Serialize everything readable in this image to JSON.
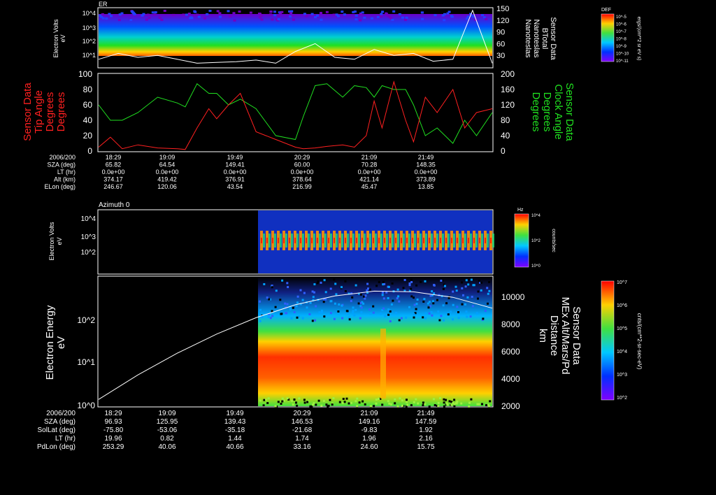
{
  "chart_data": [
    {
      "type": "heatmap",
      "panel": "er-spectrogram",
      "title": "ER",
      "ylabel": "Electron Volts",
      "yunit": "eV",
      "yticks": [
        "10^4",
        "10^3",
        "10^2",
        "10^1"
      ],
      "ylabel_right": [
        "Sensor Data",
        "BTotal",
        "Nanoteslas",
        "Nanoteslas"
      ],
      "yticks_right": [
        150,
        120,
        90,
        60,
        30
      ],
      "ylim_right": [
        0,
        150
      ],
      "colorbar": {
        "title": "DEF",
        "label": "ergs/(cm**2 sr eV s)",
        "ticks": [
          "10^-5",
          "10^-6",
          "10^-7",
          "10^-8",
          "10^-9",
          "10^-10",
          "10^-11"
        ]
      },
      "series": [
        {
          "name": "BTotal",
          "x": [
            0,
            0.05,
            0.1,
            0.15,
            0.2,
            0.25,
            0.3,
            0.35,
            0.4,
            0.45,
            0.5,
            0.55,
            0.6,
            0.65,
            0.7,
            0.75,
            0.8,
            0.85,
            0.9,
            0.95,
            1.0
          ],
          "values": [
            20,
            35,
            25,
            30,
            20,
            10,
            12,
            14,
            18,
            10,
            40,
            60,
            25,
            20,
            45,
            30,
            35,
            15,
            20,
            145,
            10
          ]
        }
      ]
    },
    {
      "type": "line",
      "panel": "mag-angles",
      "ylabel_left": [
        "Sensor Data",
        "Tip Angle",
        "Degrees",
        "Degrees"
      ],
      "ylabel_right": [
        "Sensor Data",
        "Clock Angle",
        "Degrees",
        "Degrees"
      ],
      "ylim_left": [
        0,
        100
      ],
      "ylim_right": [
        0,
        200
      ],
      "yticks_left": [
        100,
        80,
        60,
        40,
        20,
        0
      ],
      "yticks_right": [
        200,
        160,
        120,
        80,
        40,
        0
      ],
      "series": [
        {
          "name": "Tip Angle",
          "color": "#ff2020",
          "x": [
            0,
            0.03,
            0.06,
            0.1,
            0.15,
            0.2,
            0.22,
            0.25,
            0.28,
            0.3,
            0.33,
            0.36,
            0.4,
            0.45,
            0.5,
            0.52,
            0.55,
            0.58,
            0.62,
            0.65,
            0.68,
            0.7,
            0.72,
            0.75,
            0.78,
            0.8,
            0.83,
            0.86,
            0.9,
            0.93,
            0.96,
            1.0
          ],
          "values": [
            5,
            18,
            3,
            8,
            4,
            3,
            2,
            30,
            55,
            42,
            60,
            75,
            25,
            15,
            5,
            3,
            4,
            6,
            8,
            5,
            20,
            65,
            30,
            90,
            40,
            12,
            70,
            50,
            80,
            30,
            50,
            55
          ]
        },
        {
          "name": "Clock Angle",
          "color": "#20e020",
          "x": [
            0,
            0.03,
            0.06,
            0.1,
            0.15,
            0.2,
            0.22,
            0.25,
            0.28,
            0.3,
            0.33,
            0.36,
            0.4,
            0.45,
            0.5,
            0.52,
            0.55,
            0.58,
            0.62,
            0.65,
            0.68,
            0.7,
            0.72,
            0.75,
            0.78,
            0.8,
            0.83,
            0.86,
            0.9,
            0.93,
            0.96,
            1.0
          ],
          "values": [
            120,
            80,
            80,
            100,
            140,
            125,
            115,
            175,
            150,
            150,
            120,
            135,
            110,
            40,
            30,
            90,
            170,
            175,
            140,
            170,
            165,
            140,
            170,
            160,
            160,
            120,
            40,
            60,
            20,
            80,
            40,
            100
          ]
        }
      ]
    },
    {
      "type": "heatmap",
      "panel": "azimuth-spectrogram",
      "title": "Azimuth 0",
      "ylabel": "Electron Volts",
      "yunit": "eV",
      "yticks": [
        "10^4",
        "10^3",
        "10^2"
      ],
      "colorbar": {
        "title": "Hz",
        "label": "counts/sec",
        "ticks": [
          "10^4",
          "10^2",
          "10^0"
        ]
      }
    },
    {
      "type": "heatmap",
      "panel": "electron-energy-spectrogram",
      "ylabel": "Electron Energy",
      "yunit": "eV",
      "yticks": [
        "10^2",
        "10^1",
        "10^0"
      ],
      "ylabel_right": [
        "Sensor Data",
        "MEx Alt/Mars/Pd",
        "Distance",
        "km"
      ],
      "yticks_right": [
        10000,
        8000,
        6000,
        4000,
        2000
      ],
      "ylim_right": [
        2000,
        11500
      ],
      "colorbar": {
        "label": "cnts/(cm**2-sr-sec-eV)",
        "ticks": [
          "10^7",
          "10^6",
          "10^5",
          "10^4",
          "10^3",
          "10^2"
        ]
      },
      "series": [
        {
          "name": "MEx Alt/Mars/Pd",
          "x": [
            0,
            0.1,
            0.2,
            0.3,
            0.4,
            0.5,
            0.6,
            0.7,
            0.8,
            0.9,
            1.0
          ],
          "values": [
            2500,
            4300,
            5900,
            7300,
            8500,
            9450,
            10100,
            10450,
            10400,
            10000,
            9200
          ]
        }
      ]
    }
  ],
  "ephem1": {
    "labels": [
      "2006/200",
      "SZA (deg)",
      "LT (hr)",
      "Alt (km)",
      "ELon (deg)"
    ],
    "columns": [
      [
        "18:29",
        "65.82",
        "0.0e+00",
        "374.17",
        "246.67"
      ],
      [
        "19:09",
        "64.54",
        "0.0e+00",
        "419.42",
        "120.06"
      ],
      [
        "19:49",
        "149.41",
        "0.0e+00",
        "376.91",
        "43.54"
      ],
      [
        "20:29",
        "60.00",
        "0.0e+00",
        "378.64",
        "216.99"
      ],
      [
        "21:09",
        "70.28",
        "0.0e+00",
        "421.14",
        "45.47"
      ],
      [
        "21:49",
        "148.35",
        "0.0e+00",
        "373.89",
        "13.85"
      ]
    ]
  },
  "ephem2": {
    "labels": [
      "2006/200",
      "SZA (deg)",
      "SolLat (deg)",
      "LT (hr)",
      "PdLon (deg)"
    ],
    "columns": [
      [
        "18:29",
        "96.93",
        "-75.80",
        "19.96",
        "253.29"
      ],
      [
        "19:09",
        "125.95",
        "-53.06",
        "0.82",
        "40.06"
      ],
      [
        "19:49",
        "139.43",
        "-35.18",
        "1.44",
        "40.66"
      ],
      [
        "20:29",
        "146.53",
        "-21.68",
        "1.74",
        "33.16"
      ],
      [
        "21:09",
        "149.16",
        "-9.83",
        "1.96",
        "24.60"
      ],
      [
        "21:49",
        "147.59",
        "1.92",
        "2.16",
        "15.75"
      ]
    ]
  }
}
